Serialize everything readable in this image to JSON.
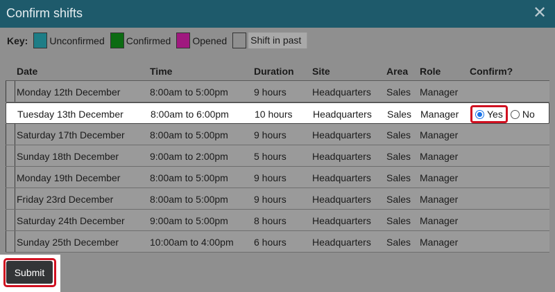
{
  "dialog": {
    "title": "Confirm shifts",
    "close_glyph": "✕"
  },
  "key": {
    "label": "Key:",
    "items": [
      {
        "label": "Unconfirmed",
        "color": "#1e7d86"
      },
      {
        "label": "Confirmed",
        "color": "#0c6b12"
      },
      {
        "label": "Opened",
        "color": "#a0197f"
      }
    ],
    "past_label": "Shift in past"
  },
  "table": {
    "headers": {
      "date": "Date",
      "time": "Time",
      "duration": "Duration",
      "site": "Site",
      "area": "Area",
      "role": "Role",
      "confirm": "Confirm?"
    },
    "rows": [
      {
        "date": "Monday 12th December",
        "time": "8:00am to 5:00pm",
        "duration": "9 hours",
        "site": "Headquarters",
        "area": "Sales",
        "role": "Manager"
      },
      {
        "date": "Tuesday 13th December",
        "time": "8:00am to 6:00pm",
        "duration": "10 hours",
        "site": "Headquarters",
        "area": "Sales",
        "role": "Manager"
      },
      {
        "date": "Saturday 17th December",
        "time": "8:00am to 5:00pm",
        "duration": "9 hours",
        "site": "Headquarters",
        "area": "Sales",
        "role": "Manager"
      },
      {
        "date": "Sunday 18th December",
        "time": "9:00am to 2:00pm",
        "duration": "5 hours",
        "site": "Headquarters",
        "area": "Sales",
        "role": "Manager"
      },
      {
        "date": "Monday 19th December",
        "time": "8:00am to 5:00pm",
        "duration": "9 hours",
        "site": "Headquarters",
        "area": "Sales",
        "role": "Manager"
      },
      {
        "date": "Friday 23rd December",
        "time": "8:00am to 5:00pm",
        "duration": "9 hours",
        "site": "Headquarters",
        "area": "Sales",
        "role": "Manager"
      },
      {
        "date": "Saturday 24th December",
        "time": "9:00am to 5:00pm",
        "duration": "8 hours",
        "site": "Headquarters",
        "area": "Sales",
        "role": "Manager"
      },
      {
        "date": "Sunday 25th December",
        "time": "10:00am to 4:00pm",
        "duration": "6 hours",
        "site": "Headquarters",
        "area": "Sales",
        "role": "Manager"
      }
    ],
    "confirm": {
      "yes": "Yes",
      "no": "No",
      "selected": "Yes"
    }
  },
  "submit_label": "Submit"
}
